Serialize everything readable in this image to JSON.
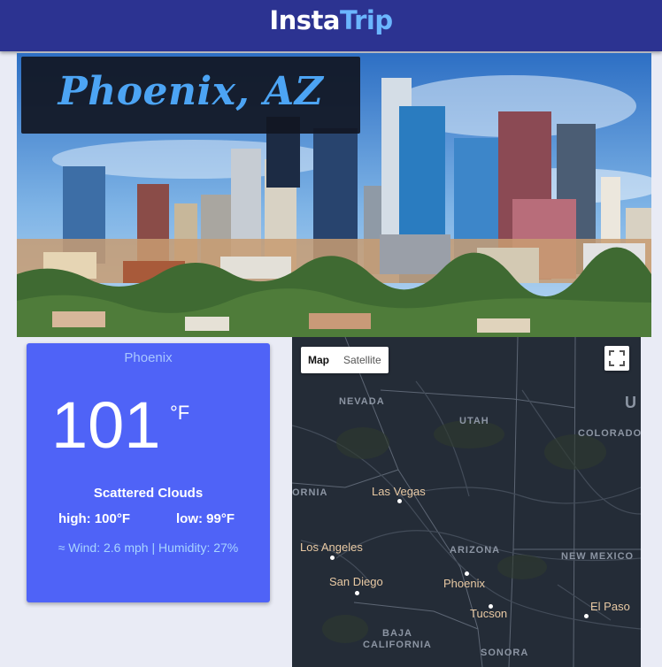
{
  "header": {
    "brand_part1": "Insta",
    "brand_part2": "Trip"
  },
  "hero": {
    "city_title": "Phoenix, AZ",
    "image": "city-skyline-photo"
  },
  "weather": {
    "city": "Phoenix",
    "temp": "101",
    "unit": "°F",
    "description": "Scattered Clouds",
    "high": "high: 100°F",
    "low": "low: 99°F",
    "extra": "≈ Wind: 2.6 mph | Humidity: 27%"
  },
  "map": {
    "type_map": "Map",
    "type_satellite": "Satellite",
    "regions": {
      "nevada": "NEVADA",
      "utah": "UTAH",
      "colorado": "COLORADO",
      "california": "ORNIA",
      "arizona": "ARIZONA",
      "new_mexico": "NEW MEXICO",
      "baja_line1": "BAJA",
      "baja_line2": "CALIFORNIA",
      "sonora": "SONORA",
      "edge_u": "U"
    },
    "cities": {
      "las_vegas": "Las Vegas",
      "los_angeles": "Los Angeles",
      "san_diego": "San Diego",
      "phoenix": "Phoenix",
      "tucson": "Tucson",
      "el_paso": "El Paso"
    }
  },
  "colors": {
    "header_bg": "#2c3391",
    "brand_accent": "#6bb6ff",
    "card_bg": "#4f63f7",
    "map_bg": "#242c37",
    "page_bg": "#e9ebf5"
  }
}
